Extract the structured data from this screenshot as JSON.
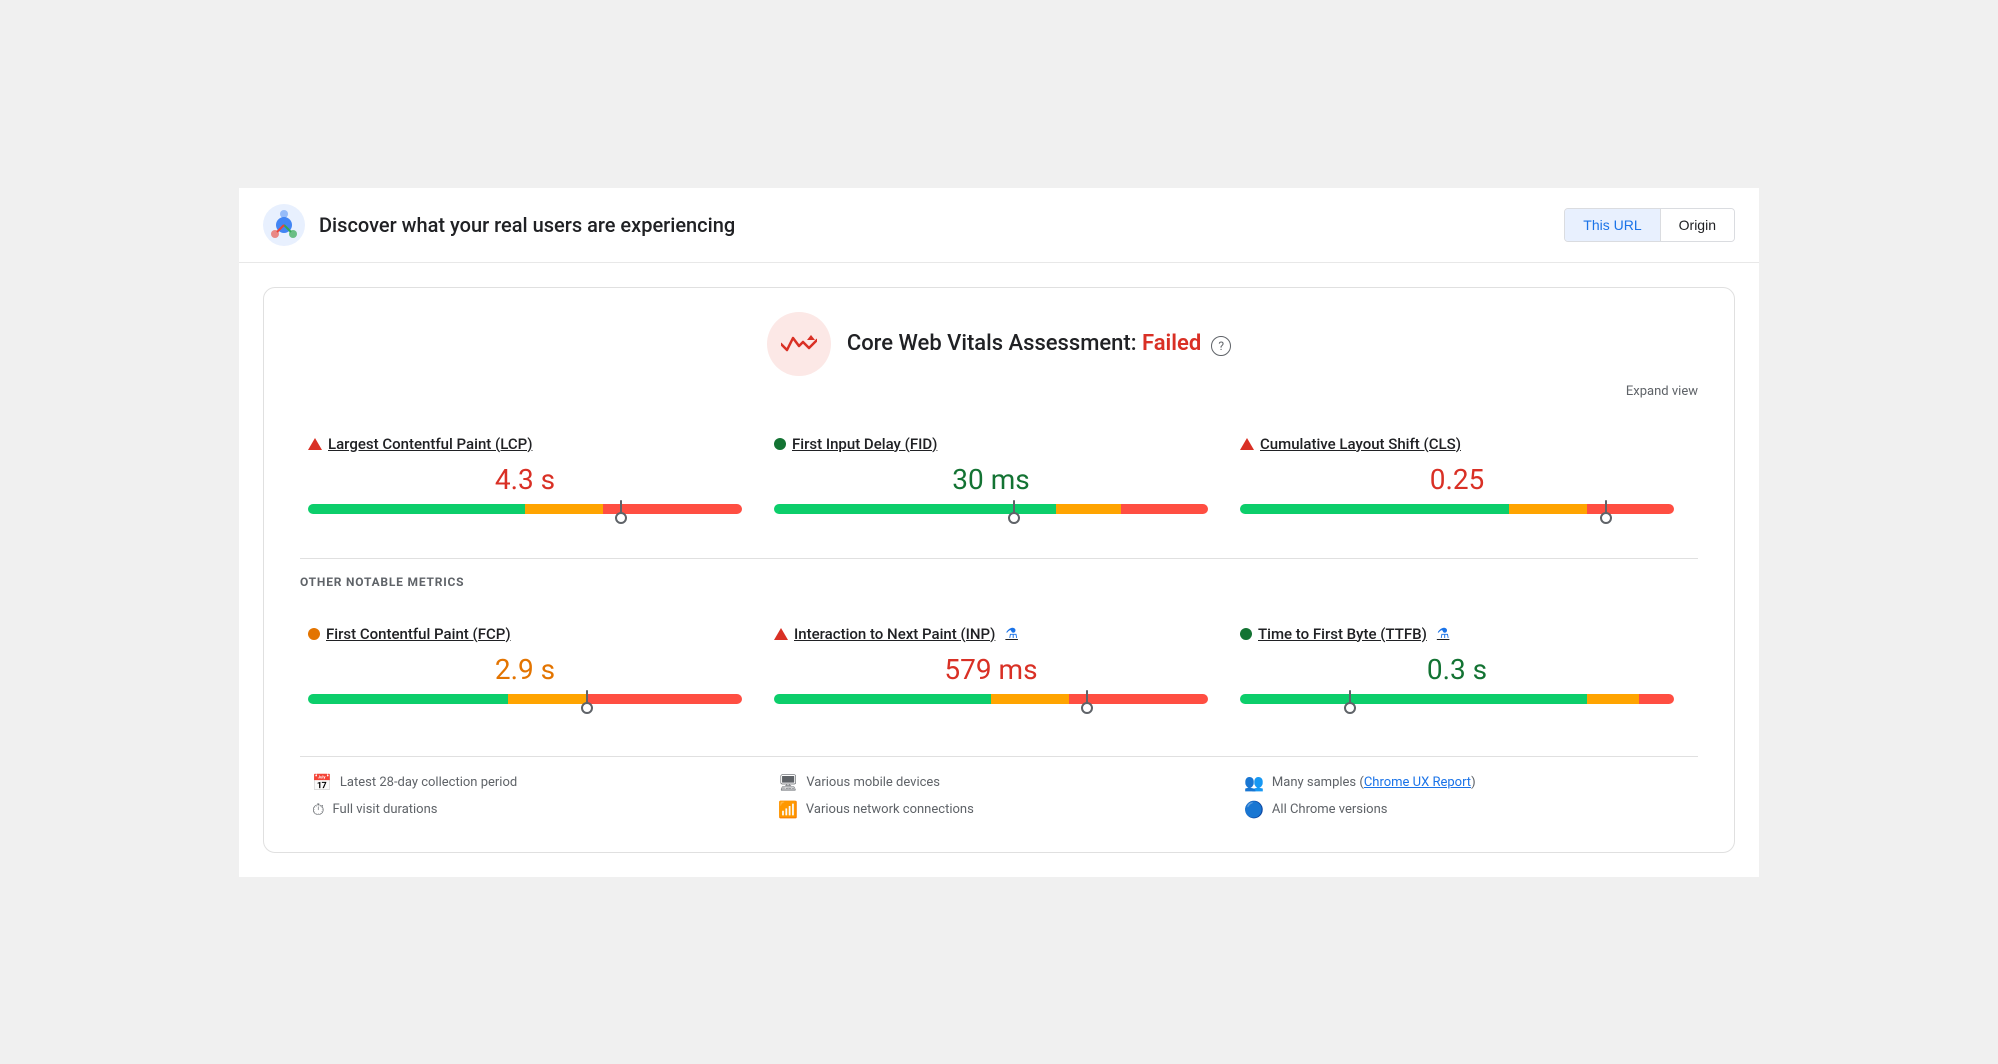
{
  "header": {
    "title": "Discover what your real users are experiencing",
    "this_url_label": "This URL",
    "origin_label": "Origin",
    "active_tab": "this_url"
  },
  "cwv": {
    "assessment_prefix": "Core Web Vitals Assessment: ",
    "status": "Failed",
    "expand_label": "Expand view"
  },
  "core_metrics": [
    {
      "id": "lcp",
      "indicator": "triangle-red",
      "title": "Largest Contentful Paint (LCP)",
      "value": "4.3 s",
      "value_color": "red",
      "gauge": {
        "green_pct": 50,
        "orange_pct": 18,
        "red_pct": 32,
        "marker_pct": 72
      }
    },
    {
      "id": "fid",
      "indicator": "dot-green",
      "title": "First Input Delay (FID)",
      "value": "30 ms",
      "value_color": "green",
      "gauge": {
        "green_pct": 65,
        "orange_pct": 15,
        "red_pct": 20,
        "marker_pct": 55
      }
    },
    {
      "id": "cls",
      "indicator": "triangle-red",
      "title": "Cumulative Layout Shift (CLS)",
      "value": "0.25",
      "value_color": "red",
      "gauge": {
        "green_pct": 62,
        "orange_pct": 18,
        "red_pct": 20,
        "marker_pct": 84
      }
    }
  ],
  "section_label": "OTHER NOTABLE METRICS",
  "other_metrics": [
    {
      "id": "fcp",
      "indicator": "dot-orange",
      "title": "First Contentful Paint (FCP)",
      "value": "2.9 s",
      "value_color": "orange",
      "has_lab": false,
      "gauge": {
        "green_pct": 46,
        "orange_pct": 18,
        "red_pct": 36,
        "marker_pct": 64
      }
    },
    {
      "id": "inp",
      "indicator": "triangle-red",
      "title": "Interaction to Next Paint (INP)",
      "value": "579 ms",
      "value_color": "red",
      "has_lab": true,
      "gauge": {
        "green_pct": 50,
        "orange_pct": 18,
        "red_pct": 32,
        "marker_pct": 72
      }
    },
    {
      "id": "ttfb",
      "indicator": "dot-green",
      "title": "Time to First Byte (TTFB)",
      "value": "0.3 s",
      "value_color": "green",
      "has_lab": true,
      "gauge": {
        "green_pct": 80,
        "orange_pct": 12,
        "red_pct": 8,
        "marker_pct": 25
      }
    }
  ],
  "footer": {
    "col1": [
      {
        "icon": "📅",
        "text": "Latest 28-day collection period"
      },
      {
        "icon": "⏱",
        "text": "Full visit durations"
      }
    ],
    "col2": [
      {
        "icon": "🖥",
        "text": "Various mobile devices"
      },
      {
        "icon": "📶",
        "text": "Various network connections"
      }
    ],
    "col3": [
      {
        "icon": "👥",
        "text": "Many samples (",
        "link": "Chrome UX Report",
        "text_after": ")"
      },
      {
        "icon": "🔵",
        "text": "All Chrome versions"
      }
    ]
  }
}
